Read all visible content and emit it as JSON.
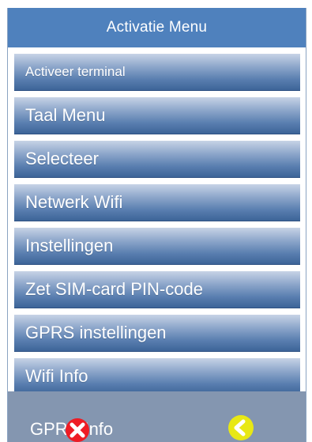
{
  "header": {
    "title": "Activatie Menu"
  },
  "menu": {
    "items": [
      {
        "label": "Activeer terminal"
      },
      {
        "label": "Taal Menu"
      },
      {
        "label": "Selecteer"
      },
      {
        "label": "Netwerk Wifi"
      },
      {
        "label": "Instellingen"
      },
      {
        "label": "Zet SIM-card PIN-code"
      },
      {
        "label": "GPRS instellingen"
      },
      {
        "label": "Wifi Info"
      }
    ]
  },
  "bottom": {
    "label": "GPRS Info",
    "close_icon": "close-icon",
    "back_icon": "chevron-left-icon"
  },
  "colors": {
    "title_bar": "#4f81bd",
    "menu_button": "#5a7fb0",
    "bottom_bar": "#8496b0",
    "close": "#ee1c24",
    "back": "#e8e815"
  }
}
